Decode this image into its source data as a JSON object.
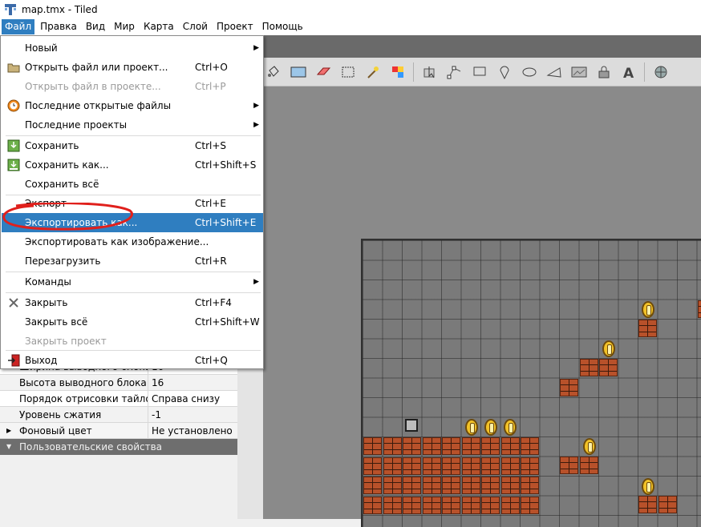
{
  "window": {
    "title": "map.tmx - Tiled"
  },
  "menubar": {
    "items": [
      {
        "label": "Файл"
      },
      {
        "label": "Правка"
      },
      {
        "label": "Вид"
      },
      {
        "label": "Мир"
      },
      {
        "label": "Карта"
      },
      {
        "label": "Слой"
      },
      {
        "label": "Проект"
      },
      {
        "label": "Помощь"
      }
    ]
  },
  "file_menu": {
    "new": {
      "label": "Новый"
    },
    "open_file_or_project": {
      "label": "Открыть файл или проект...",
      "shortcut": "Ctrl+O"
    },
    "open_file_in_project": {
      "label": "Открыть файл в проекте...",
      "shortcut": "Ctrl+P"
    },
    "recent_files": {
      "label": "Последние открытые файлы"
    },
    "recent_projects": {
      "label": "Последние проекты"
    },
    "save": {
      "label": "Сохранить",
      "shortcut": "Ctrl+S"
    },
    "save_as": {
      "label": "Сохранить как...",
      "shortcut": "Ctrl+Shift+S"
    },
    "save_all": {
      "label": "Сохранить всё"
    },
    "export": {
      "label": "Экспорт",
      "shortcut": "Ctrl+E"
    },
    "export_as": {
      "label": "Экспортировать как...",
      "shortcut": "Ctrl+Shift+E"
    },
    "export_as_image": {
      "label": "Экспортировать как изображение..."
    },
    "reload": {
      "label": "Перезагрузить",
      "shortcut": "Ctrl+R"
    },
    "commands": {
      "label": "Команды"
    },
    "close": {
      "label": "Закрыть",
      "shortcut": "Ctrl+F4"
    },
    "close_all": {
      "label": "Закрыть всё",
      "shortcut": "Ctrl+Shift+W"
    },
    "close_project": {
      "label": "Закрыть проект"
    },
    "exit": {
      "label": "Выход",
      "shortcut": "Ctrl+Q"
    }
  },
  "properties": {
    "rows": [
      {
        "key": "Ширина выводного блока",
        "value": "16"
      },
      {
        "key": "Высота выводного блока",
        "value": "16"
      },
      {
        "key": "Порядок отрисовки тайлов",
        "value": "Справа снизу"
      },
      {
        "key": "Уровень сжатия",
        "value": "-1"
      },
      {
        "key": "Фоновый цвет",
        "value": "Не установлено"
      }
    ],
    "custom_section": "Пользовательские свойства"
  },
  "colors": {
    "accent": "#2f7ec0",
    "annotation": "#e0201c"
  }
}
